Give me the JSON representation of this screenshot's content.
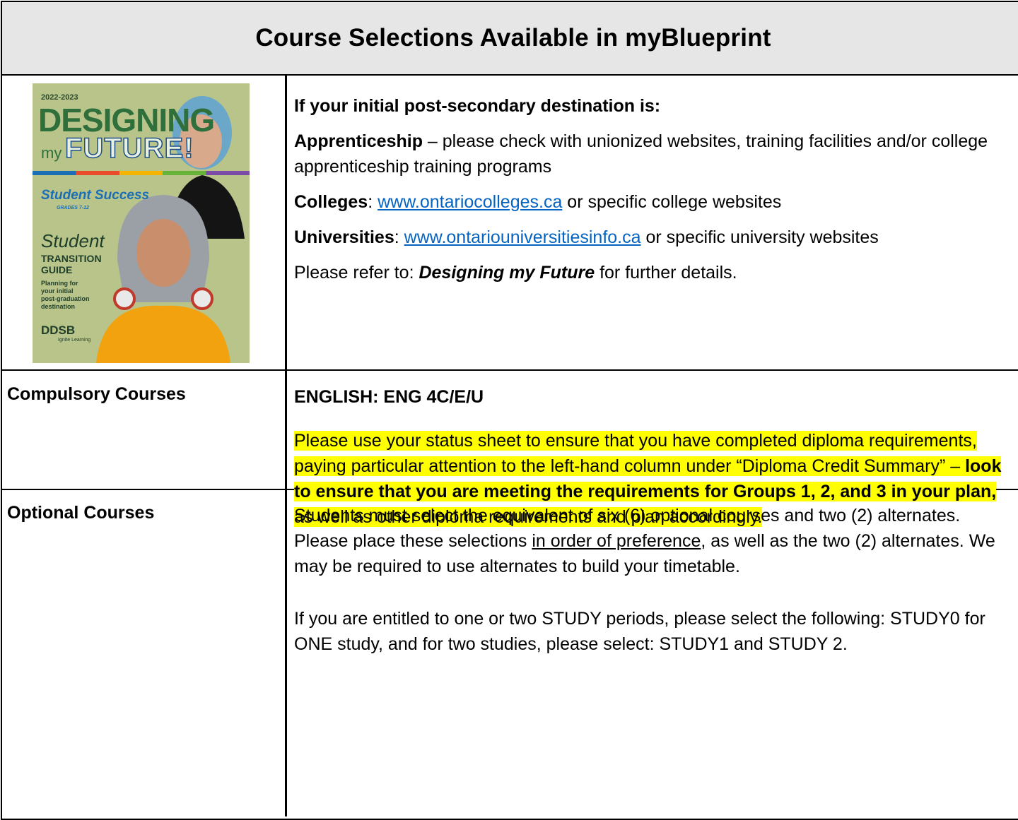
{
  "title": "Course Selections Available in myBlueprint",
  "brochure": {
    "year": "2022-2023",
    "line1": "DESIGNING",
    "line2_prefix": "my",
    "line2": "FUTURE!",
    "student_success": "Student Success",
    "grades": "GRADES 7-12",
    "student": "Student",
    "transition": "TRANSITION",
    "guide": "GUIDE",
    "planning": [
      "Planning for",
      "your initial",
      "post-graduation",
      "destination"
    ],
    "board": "DDSB",
    "board_tagline": "Ignite Learning"
  },
  "destination": {
    "heading": "If your initial post-secondary destination is:",
    "apprenticeship_label": "Apprenticeship",
    "apprenticeship_text": " – please check with unionized websites, training facilities and/or college apprenticeship training programs",
    "colleges_label": "Colleges",
    "colleges_link": "www.ontariocolleges.ca",
    "colleges_text": " or specific college websites",
    "universities_label": "Universities",
    "universities_link": "www.ontariouniversitiesinfo.ca",
    "universities_text": " or specific university websites",
    "refer_prefix": "Please refer to: ",
    "refer_title": "Designing my Future",
    "refer_suffix": " for further details."
  },
  "compulsory": {
    "label": "Compulsory Courses",
    "english": "ENGLISH:  ENG 4C/E/U",
    "note_part1": "Please use your status sheet to ensure that you have completed diploma requirements, paying particular attention to the left-hand column under “Diploma Credit Summary” – ",
    "note_bold": "look to ensure that you are meeting the requirements for Groups 1, 2, and 3 in your plan,",
    "note_part2": " as well as other diploma requirements and plan accordingly."
  },
  "optional": {
    "label": "Optional Courses",
    "para1_a": "Students must select the equivalent of six (6) optional courses and two (2) alternates.  Please place these selections ",
    "para1_underline": "in order of preference",
    "para1_b": ", as well as the two (2) alternates.  We may be required to use alternates to build your timetable.",
    "para2": "If you are entitled to one or two STUDY periods, please select the following:  STUDY0 for ONE study, and for two studies, please select: STUDY1 and STUDY 2."
  }
}
